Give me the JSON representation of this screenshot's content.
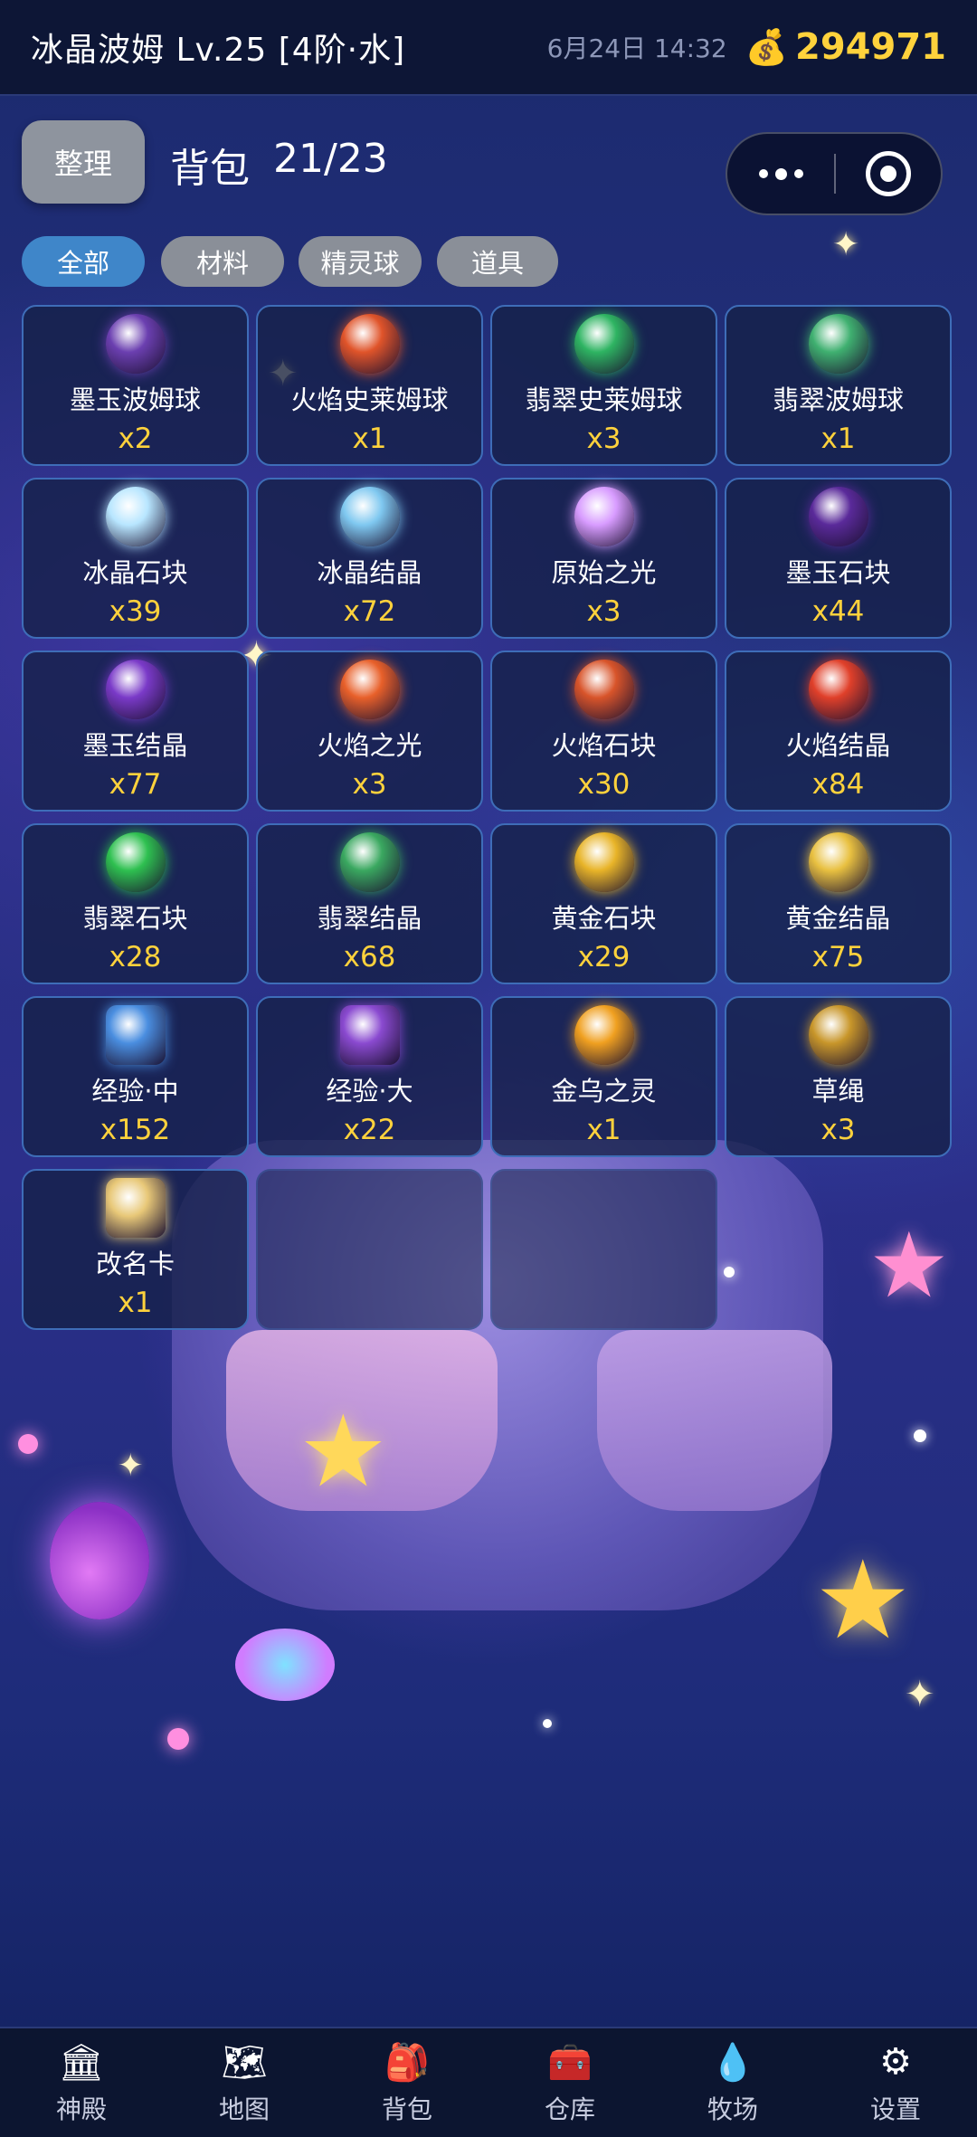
{
  "status": {
    "player": "冰晶波姆 Lv.25 [4阶·水]",
    "datetime": "6月24日 14:32",
    "coin_icon": "money-bag-icon",
    "coins": "294971"
  },
  "header": {
    "sort_label": "整理",
    "title": "背包",
    "count": "21/23"
  },
  "tabs": [
    {
      "label": "全部",
      "active": true
    },
    {
      "label": "材料",
      "active": false
    },
    {
      "label": "精灵球",
      "active": false
    },
    {
      "label": "道具",
      "active": false
    }
  ],
  "items": [
    {
      "name": "墨玉波姆球",
      "qty": "x2",
      "icon": "dark-jade-ball-icon",
      "color": "#6b3fb0"
    },
    {
      "name": "火焰史莱姆球",
      "qty": "x1",
      "icon": "fire-slime-ball-icon",
      "color": "#e0542a"
    },
    {
      "name": "翡翠史莱姆球",
      "qty": "x3",
      "icon": "emerald-slime-ball-icon",
      "color": "#2eb462"
    },
    {
      "name": "翡翠波姆球",
      "qty": "x1",
      "icon": "emerald-bom-ball-icon",
      "color": "#3fb070"
    },
    {
      "name": "冰晶石块",
      "qty": "x39",
      "icon": "ice-stone-icon",
      "color": "#b8e6ff"
    },
    {
      "name": "冰晶结晶",
      "qty": "x72",
      "icon": "ice-crystal-icon",
      "color": "#7fc8f0"
    },
    {
      "name": "原始之光",
      "qty": "x3",
      "icon": "primal-light-orb-icon",
      "color": "#d89cff"
    },
    {
      "name": "墨玉石块",
      "qty": "x44",
      "icon": "dark-jade-stone-icon",
      "color": "#5a2a9a"
    },
    {
      "name": "墨玉结晶",
      "qty": "x77",
      "icon": "dark-jade-crystal-icon",
      "color": "#7a3ac8"
    },
    {
      "name": "火焰之光",
      "qty": "x3",
      "icon": "fire-light-orb-icon",
      "color": "#e8602a"
    },
    {
      "name": "火焰石块",
      "qty": "x30",
      "icon": "fire-stone-icon",
      "color": "#d8542a"
    },
    {
      "name": "火焰结晶",
      "qty": "x84",
      "icon": "fire-crystal-icon",
      "color": "#e0402a"
    },
    {
      "name": "翡翠石块",
      "qty": "x28",
      "icon": "emerald-stone-icon",
      "color": "#2ec050"
    },
    {
      "name": "翡翠结晶",
      "qty": "x68",
      "icon": "emerald-crystal-icon",
      "color": "#3aa860"
    },
    {
      "name": "黄金石块",
      "qty": "x29",
      "icon": "gold-stone-icon",
      "color": "#e8b428"
    },
    {
      "name": "黄金结晶",
      "qty": "x75",
      "icon": "gold-crystal-icon",
      "color": "#e8c040"
    },
    {
      "name": "经验·中",
      "qty": "x152",
      "icon": "exp-book-medium-icon",
      "color": "#4a8ee0"
    },
    {
      "name": "经验·大",
      "qty": "x22",
      "icon": "exp-book-large-icon",
      "color": "#8a4ad0"
    },
    {
      "name": "金乌之灵",
      "qty": "x1",
      "icon": "golden-crow-spirit-icon",
      "color": "#f0a020"
    },
    {
      "name": "草绳",
      "qty": "x3",
      "icon": "straw-rope-icon",
      "color": "#c8962a"
    },
    {
      "name": "改名卡",
      "qty": "x1",
      "icon": "rename-card-icon",
      "color": "#e8c878"
    }
  ],
  "empty_slots": 2,
  "nav": [
    {
      "label": "神殿",
      "icon": "temple-icon"
    },
    {
      "label": "地图",
      "icon": "map-icon"
    },
    {
      "label": "背包",
      "icon": "backpack-icon"
    },
    {
      "label": "仓库",
      "icon": "warehouse-chest-icon"
    },
    {
      "label": "牧场",
      "icon": "ranch-slime-icon"
    },
    {
      "label": "设置",
      "icon": "gear-icon"
    }
  ]
}
